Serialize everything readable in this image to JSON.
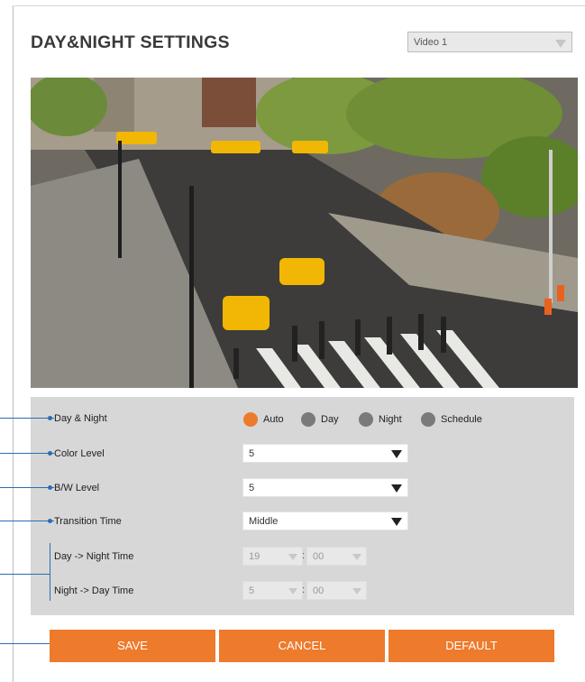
{
  "page": {
    "title": "DAY&NIGHT SETTINGS"
  },
  "video_select": {
    "value": "Video 1"
  },
  "camera_view": {
    "description_icon": "camera-snapshot"
  },
  "settings": {
    "day_night": {
      "label": "Day & Night",
      "options": [
        "Auto",
        "Day",
        "Night",
        "Schedule"
      ],
      "selected": "Auto"
    },
    "color_level": {
      "label": "Color Level",
      "value": "5"
    },
    "bw_level": {
      "label": "B/W Level",
      "value": "5"
    },
    "transition_time": {
      "label": "Transition Time",
      "value": "Middle"
    },
    "day_to_night": {
      "label": "Day -> Night Time",
      "hour": "19",
      "minute": "00"
    },
    "night_to_day": {
      "label": "Night -> Day Time",
      "hour": "5",
      "minute": "00"
    }
  },
  "buttons": {
    "save": "SAVE",
    "cancel": "CANCEL",
    "default": "DEFAULT"
  },
  "colors": {
    "accent": "#ee7a2b",
    "connector": "#2a6db5",
    "panel": "#d7d7d7"
  }
}
